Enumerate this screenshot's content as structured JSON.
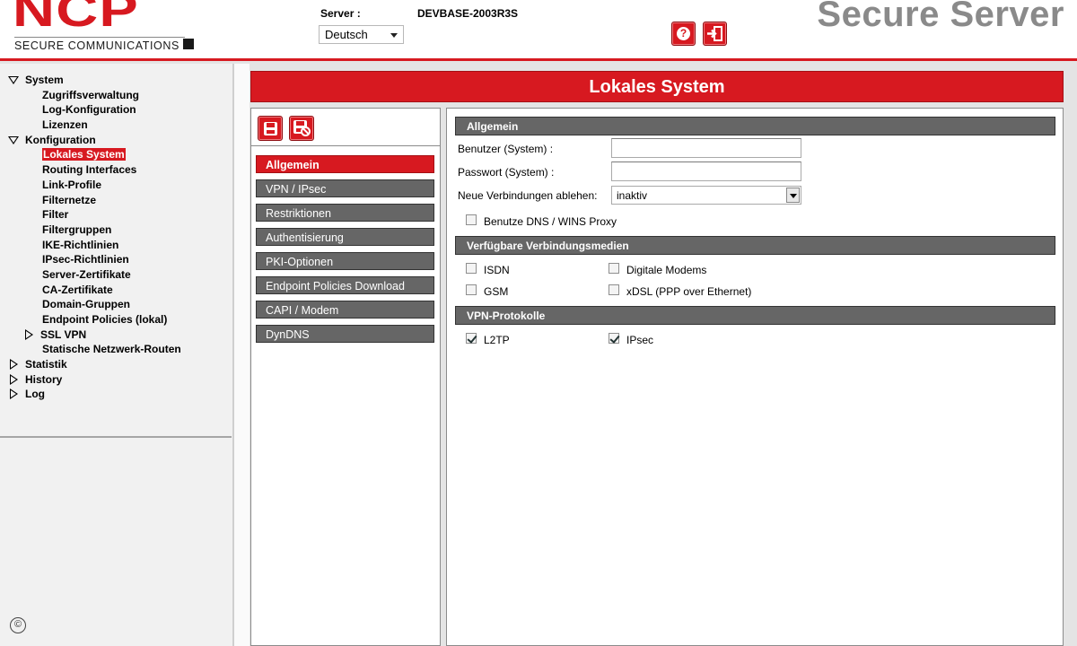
{
  "header": {
    "logo_text": "NCP",
    "logo_company": "SECURE COMMUNICATIONS",
    "server_label": "Server :",
    "server_value": "DEVBASE-2003R3S",
    "language": "Deutsch",
    "product_name": "Secure Server",
    "icons": {
      "help": "help-icon",
      "logout": "logout-icon"
    }
  },
  "nav_tree": {
    "system": "System",
    "zugriffsverwaltung": "Zugriffsverwaltung",
    "log_konfiguration": "Log-Konfiguration",
    "lizenzen": "Lizenzen",
    "konfiguration": "Konfiguration",
    "lokales_system": "Lokales System",
    "routing_interfaces": "Routing Interfaces",
    "link_profile": "Link-Profile",
    "filternetze": "Filternetze",
    "filter": "Filter",
    "filtergruppen": "Filtergruppen",
    "ike_richtlinien": "IKE-Richtlinien",
    "ipsec_richtlinien": "IPsec-Richtlinien",
    "server_zertifikate": "Server-Zertifikate",
    "ca_zertifikate": "CA-Zertifikate",
    "domain_gruppen": "Domain-Gruppen",
    "endpoint_policies_lokal": "Endpoint Policies (lokal)",
    "ssl_vpn": "SSL VPN",
    "statische_routen": "Statische Netzwerk-Routen",
    "statistik": "Statistik",
    "history": "History",
    "log": "Log",
    "copyright_symbol": "©"
  },
  "page_title": "Lokales System",
  "toolbar": {
    "save_icon": "save-icon",
    "discard_icon": "discard-icon"
  },
  "subnav": {
    "items": [
      "Allgemein",
      "VPN / IPsec",
      "Restriktionen",
      "Authentisierung",
      "PKI-Optionen",
      "Endpoint Policies Download",
      "CAPI / Modem",
      "DynDNS"
    ],
    "active_index": 0
  },
  "content": {
    "allgemein": {
      "title": "Allgemein",
      "benutzer_label": "Benutzer (System) :",
      "benutzer_value": "",
      "passwort_label": "Passwort (System) :",
      "passwort_value": "",
      "neue_verbindungen_label": "Neue Verbindungen ablehen:",
      "neue_verbindungen_value": "inaktiv",
      "dns_proxy_label": "Benutze DNS / WINS Proxy",
      "dns_proxy_checked": false
    },
    "medien": {
      "title": "Verfügbare Verbindungsmedien",
      "isdn_label": "ISDN",
      "isdn_checked": false,
      "modems_label": "Digitale Modems",
      "modems_checked": false,
      "gsm_label": "GSM",
      "gsm_checked": false,
      "xdsl_label": "xDSL (PPP over Ethernet)",
      "xdsl_checked": false
    },
    "vpn_protokolle": {
      "title": "VPN-Protokolle",
      "l2tp_label": "L2TP",
      "l2tp_checked": true,
      "ipsec_label": "IPsec",
      "ipsec_checked": true
    }
  },
  "colors": {
    "brand_red": "#d71920",
    "section_gray": "#666666",
    "product_gray": "#8a8a8a"
  }
}
